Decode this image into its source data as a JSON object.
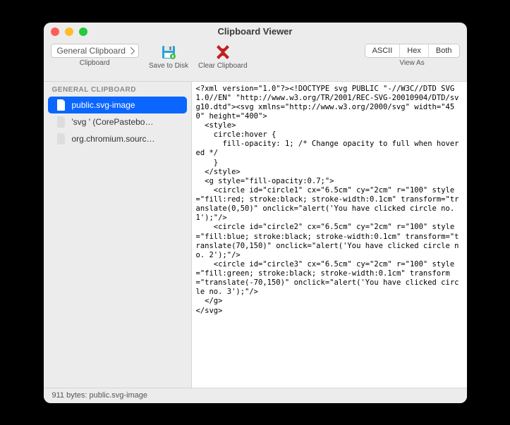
{
  "window": {
    "title": "Clipboard Viewer"
  },
  "toolbar": {
    "clipboard_selector": "General Clipboard",
    "clipboard_label": "Clipboard",
    "save_label": "Save to Disk",
    "clear_label": "Clear Clipboard",
    "viewas_label": "View As",
    "segments": {
      "ascii": "ASCII",
      "hex": "Hex",
      "both": "Both"
    }
  },
  "sidebar": {
    "header": "GENERAL CLIPBOARD",
    "items": [
      {
        "label": "public.svg-image",
        "selected": true
      },
      {
        "label": "'svg ' (CorePastebo…",
        "selected": false
      },
      {
        "label": "org.chromium.sourc…",
        "selected": false
      }
    ]
  },
  "content": {
    "text": "<?xml version=\"1.0\"?><!DOCTYPE svg PUBLIC \"-//W3C//DTD SVG 1.0//EN\" \"http://www.w3.org/TR/2001/REC-SVG-20010904/DTD/svg10.dtd\"><svg xmlns=\"http://www.w3.org/2000/svg\" width=\"450\" height=\"400\">\n  <style>\n    circle:hover {\n      fill-opacity: 1; /* Change opacity to full when hovered */\n    }\n  </style>\n  <g style=\"fill-opacity:0.7;\">\n    <circle id=\"circle1\" cx=\"6.5cm\" cy=\"2cm\" r=\"100\" style=\"fill:red; stroke:black; stroke-width:0.1cm\" transform=\"translate(0,50)\" onclick=\"alert('You have clicked circle no. 1');\"/>\n    <circle id=\"circle2\" cx=\"6.5cm\" cy=\"2cm\" r=\"100\" style=\"fill:blue; stroke:black; stroke-width:0.1cm\" transform=\"translate(70,150)\" onclick=\"alert('You have clicked circle no. 2');\"/>\n    <circle id=\"circle3\" cx=\"6.5cm\" cy=\"2cm\" r=\"100\" style=\"fill:green; stroke:black; stroke-width:0.1cm\" transform=\"translate(-70,150)\" onclick=\"alert('You have clicked circle no. 3');\"/>\n  </g>\n</svg>"
  },
  "statusbar": {
    "text": "911 bytes: public.svg-image"
  }
}
